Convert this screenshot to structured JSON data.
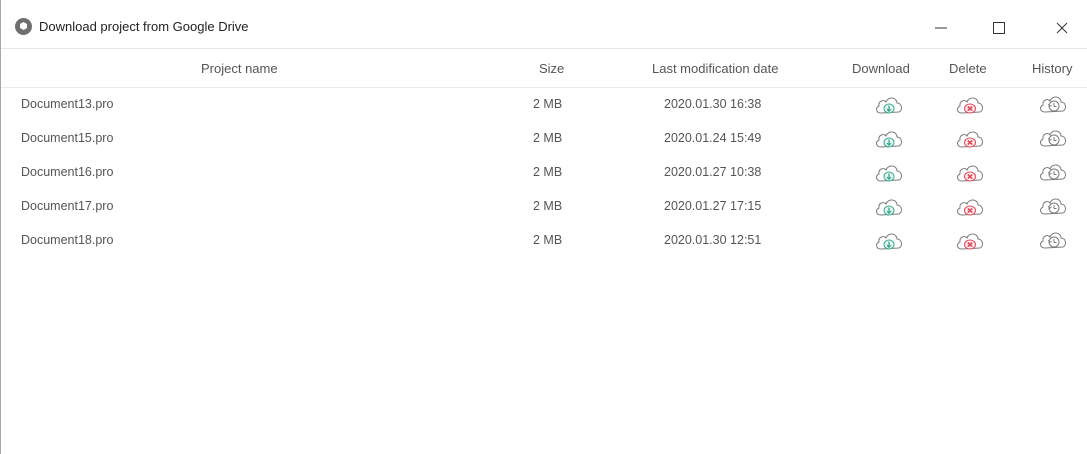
{
  "window": {
    "title": "Download project from Google Drive",
    "controls": [
      "minimize",
      "maximize",
      "close"
    ]
  },
  "table": {
    "columns": {
      "name": "Project name",
      "size": "Size",
      "date": "Last modification date",
      "download": "Download",
      "delete": "Delete",
      "history": "History"
    },
    "rows": [
      {
        "name": "Document13.pro",
        "size": "2 MB",
        "date": "2020.01.30  16:38"
      },
      {
        "name": "Document15.pro",
        "size": "2 MB",
        "date": "2020.01.24  15:49"
      },
      {
        "name": "Document16.pro",
        "size": "2 MB",
        "date": "2020.01.27  10:38"
      },
      {
        "name": "Document17.pro",
        "size": "2 MB",
        "date": "2020.01.27  17:15"
      },
      {
        "name": "Document18.pro",
        "size": "2 MB",
        "date": "2020.01.30  12:51"
      }
    ]
  },
  "icons": {
    "download": "cloud-download-icon",
    "delete": "cloud-delete-icon",
    "history": "history-icon"
  },
  "colors": {
    "download_accent": "#3aa890",
    "delete_accent": "#e04a5a",
    "icon_outline": "#7a7a7a"
  }
}
